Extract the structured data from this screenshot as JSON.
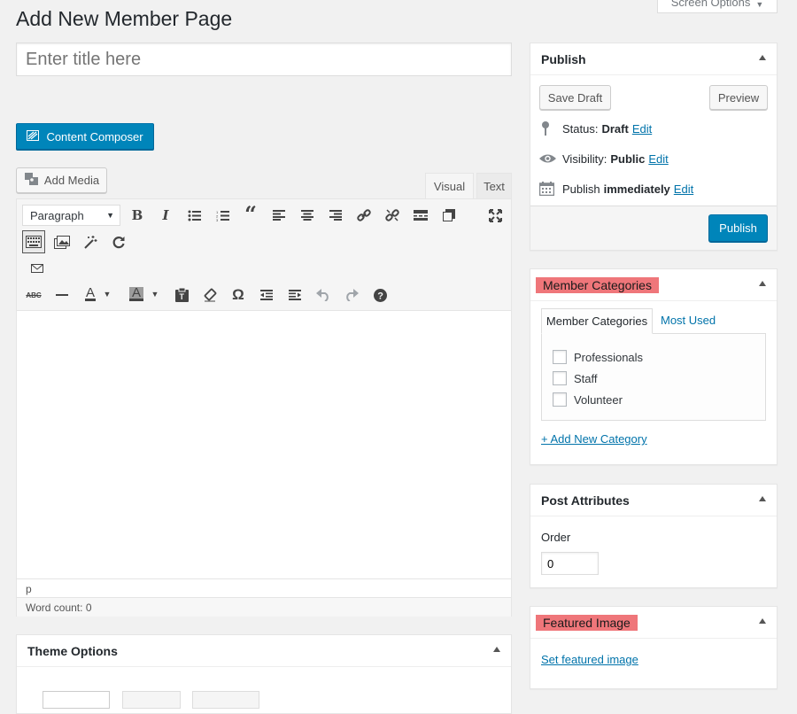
{
  "header": {
    "page_title": "Add New Member Page",
    "screen_options_label": "Screen Options"
  },
  "editor": {
    "title_placeholder": "Enter title here",
    "content_composer_label": "Content Composer",
    "add_media_label": "Add Media",
    "tab_visual": "Visual",
    "tab_text": "Text",
    "format_select_value": "Paragraph",
    "path_text": "p",
    "word_count_label": "Word count:",
    "word_count_value": "0"
  },
  "theme_options": {
    "title": "Theme Options"
  },
  "publish": {
    "title": "Publish",
    "save_draft_label": "Save Draft",
    "preview_label": "Preview",
    "status_label": "Status:",
    "status_value": "Draft",
    "visibility_label": "Visibility:",
    "visibility_value": "Public",
    "publish_label": "Publish",
    "publish_value": "immediately",
    "edit_label": "Edit",
    "publish_button_label": "Publish"
  },
  "member_categories": {
    "title": "Member Categories",
    "tab_all": "Member Categories",
    "tab_most_used": "Most Used",
    "items": [
      "Professionals",
      "Staff",
      "Volunteer"
    ],
    "add_new_label": "+ Add New Category"
  },
  "post_attributes": {
    "title": "Post Attributes",
    "order_label": "Order",
    "order_value": "0"
  },
  "featured_image": {
    "title": "Featured Image",
    "set_link": "Set featured image"
  },
  "colors": {
    "accent": "#0085ba",
    "link": "#0073aa",
    "highlight": "#ef767a"
  }
}
